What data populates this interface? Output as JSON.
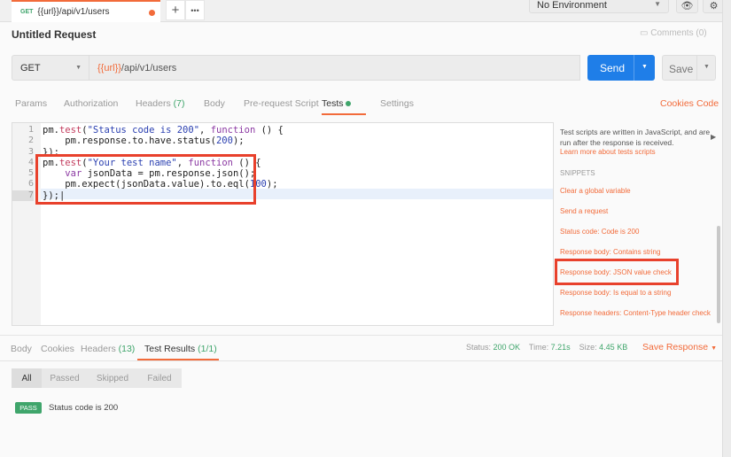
{
  "tabs": {
    "method": "GET",
    "url": "{{url}}/api/v1/users",
    "new": "+",
    "more": "•••"
  },
  "env": {
    "selected": "No Environment"
  },
  "request": {
    "title": "Untitled Request",
    "comments": "Comments (0)",
    "method": "GET",
    "url_var": "{{url}}",
    "url_path": "/api/v1/users",
    "send": "Send",
    "save": "Save"
  },
  "req_tabs": {
    "params": "Params",
    "authorization": "Authorization",
    "headers": "Headers",
    "headers_count": "(7)",
    "body": "Body",
    "prerequest": "Pre-request Script",
    "tests": "Tests",
    "settings": "Settings",
    "cookies": "Cookies",
    "code": "Code"
  },
  "editor": {
    "lines": [
      "1",
      "2",
      "3",
      "4",
      "5",
      "6",
      "7"
    ]
  },
  "side": {
    "desc": "Test scripts are written in JavaScript, and are run after the response is received.",
    "learn": "Learn more about tests scripts",
    "snippets": "SNIPPETS",
    "items": [
      "Clear a global variable",
      "Send a request",
      "Status code: Code is 200",
      "Response body: Contains string",
      "Response body: JSON value check",
      "Response body: Is equal to a string",
      "Response headers: Content-Type header check"
    ]
  },
  "response": {
    "body": "Body",
    "cookies": "Cookies",
    "headers": "Headers",
    "headers_count": "(13)",
    "test_results": "Test Results",
    "test_count": "(1/1)",
    "status_label": "Status:",
    "status": "200 OK",
    "time_label": "Time:",
    "time": "7.21s",
    "size_label": "Size:",
    "size": "4.45 KB",
    "save_response": "Save Response"
  },
  "filters": [
    "All",
    "Passed",
    "Skipped",
    "Failed"
  ],
  "results": [
    {
      "badge": "PASS",
      "name": "Status code is 200"
    }
  ],
  "colors": {
    "accent": "#f26b3a",
    "send": "#1f7ee8",
    "pass": "#3fa56b",
    "highlight": "#e8412c"
  }
}
